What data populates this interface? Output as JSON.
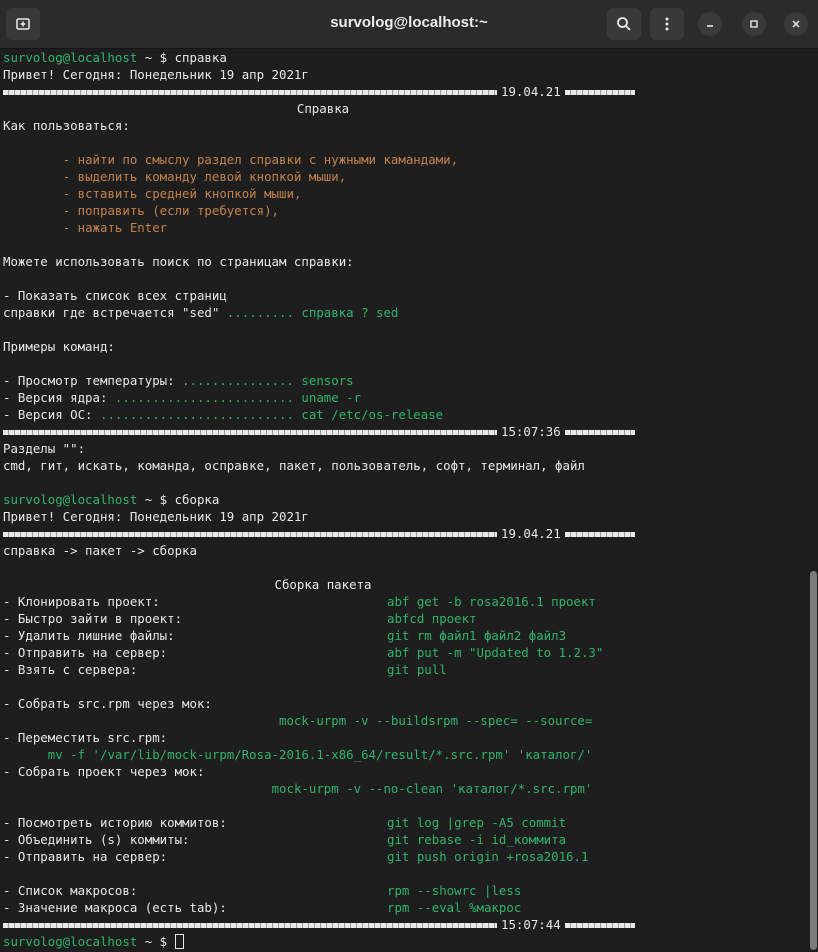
{
  "window": {
    "title": "survolog@localhost:~"
  },
  "prompt": {
    "user_host": "survolog@localhost",
    "path": " ~ $ "
  },
  "session1": {
    "command": "справка",
    "greeting": "Привет! Сегодня: Понедельник 19 апр 2021г",
    "date": "19.04.21",
    "heading": "Справка",
    "how_to": "Как пользоваться:",
    "steps": [
      "- найти по смыслу раздел справки с нужными камандами,",
      "- выделить команду левой кнопкой мыши,",
      "- вставить средней кнопкой мыши,",
      "- поправить (если требуется),",
      "- нажать Enter"
    ],
    "search_hint": "Можете использовать поиск по страницам справки:",
    "show_list": "- Показать список всех страниц",
    "where_label": "справки где встречается \"sed\" ",
    "where_dots": "......... ",
    "where_cmd": "справка ? sed",
    "examples": "Примеры команд:",
    "example_rows": [
      {
        "label": "- Просмотр температуры: ",
        "dots": "............... ",
        "cmd": "sensors"
      },
      {
        "label": "- Версия ядра: ",
        "dots": "........................ ",
        "cmd": "uname -r"
      },
      {
        "label": "- Версия ОС: ",
        "dots": ".......................... ",
        "cmd": "cat /etc/os-release"
      }
    ],
    "time": "15:07:36",
    "sections_title": "Разделы \"\":",
    "sections_list": "cmd, гит, искать, команда, осправке, пакет, пользователь, софт, терминал, файл"
  },
  "session2": {
    "command": "сборка",
    "greeting": "Привет! Сегодня: Понедельник 19 апр 2021г",
    "date": "19.04.21",
    "breadcrumb": "справка -> пакет -> сборка",
    "heading": "Сборка пакета",
    "group1": [
      {
        "label": "- Клонировать проект:",
        "cmd": "abf get -b rosa2016.1 проект"
      },
      {
        "label": "- Быстро зайти в проект:",
        "cmd": "abfcd проект"
      },
      {
        "label": "- Удалить лишние файлы:",
        "cmd": "git rm файл1 файл2 файл3"
      },
      {
        "label": "- Отправить на сервер:",
        "cmd": "abf put -m \"Updated to 1.2.3\""
      },
      {
        "label": "- Взять с сервера:",
        "cmd": "git pull"
      }
    ],
    "build_srpm_label": "- Собрать src.rpm через мок:",
    "build_srpm_cmd": "mock-urpm -v --buildsrpm --spec= --source=",
    "move_label": "- Переместить src.rpm:",
    "move_cmd": "mv -f '/var/lib/mock-urpm/Rosa-2016.1-x86_64/result/*.src.rpm' 'каталог/'",
    "build_label": "- Собрать проект через мок:",
    "build_cmd": "mock-urpm -v --no-clean 'каталог/*.src.rpm'",
    "group2": [
      {
        "label": "- Посмотреть историю коммитов:",
        "cmd": "git log |grep -A5 commit"
      },
      {
        "label": "- Объединить (s) коммиты:",
        "cmd": "git rebase -i id_коммита"
      },
      {
        "label": "- Отправить на сервер:",
        "cmd": "git push origin +rosa2016.1"
      }
    ],
    "group3": [
      {
        "label": "- Список макросов:",
        "cmd": "rpm --showrc |less"
      },
      {
        "label": "- Значение макроса (есть tab):",
        "cmd": "rpm --eval %макрос"
      }
    ],
    "time": "15:07:44"
  },
  "colors": {
    "prompt_green": "#2fb36c",
    "step_orange": "#c3814a",
    "background": "#1e1e1e",
    "titlebar": "#2b2b2b"
  },
  "icons": [
    "new-tab-icon",
    "search-icon",
    "menu-icon",
    "minimize-icon",
    "maximize-icon",
    "close-icon"
  ]
}
